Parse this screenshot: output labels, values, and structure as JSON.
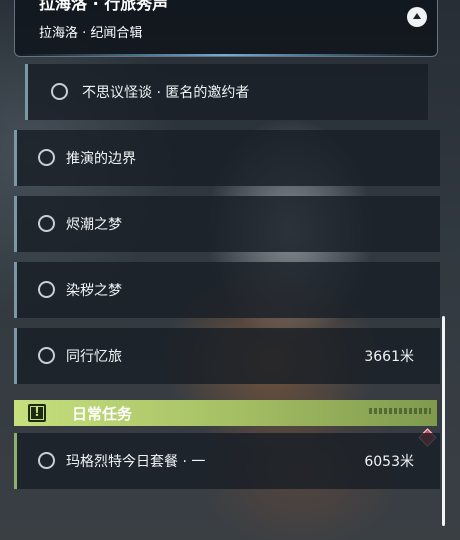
{
  "header": {
    "title": "拉海洛 · 行旅秀声",
    "subtitle": "拉海洛 · 纪闻合辑"
  },
  "quests": [
    {
      "label": "不思议怪谈 · 匿名的邀约者",
      "distance": ""
    },
    {
      "label": "推演的边界",
      "distance": ""
    },
    {
      "label": "烬潮之梦",
      "distance": ""
    },
    {
      "label": "染秽之梦",
      "distance": ""
    },
    {
      "label": "同行忆旅",
      "distance": "3661米"
    }
  ],
  "daily_section": {
    "title": "日常任务"
  },
  "daily_quests": [
    {
      "label": "玛格烈特今日套餐 · 一",
      "distance": "6053米"
    }
  ],
  "colors": {
    "quest_accent": "#7c98a4",
    "daily_accent": "#c7e07d",
    "tracking_marker": "#d94a5a"
  },
  "icons": {
    "collapse": "chevron-up-icon",
    "status": "circle-icon",
    "daily": "alert-icon",
    "tracking": "diamond-marker-icon"
  }
}
